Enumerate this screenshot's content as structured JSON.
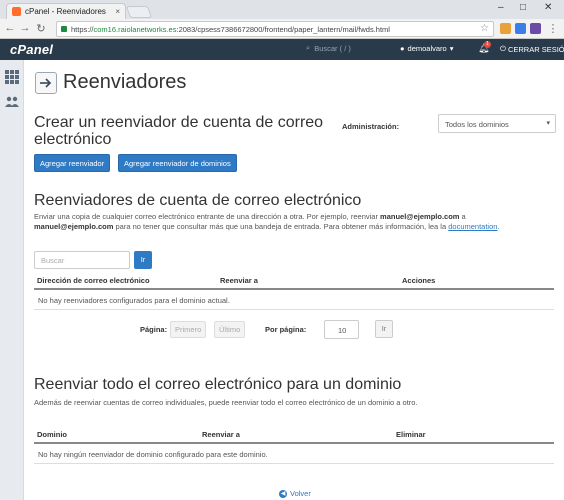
{
  "browser": {
    "tab_title": "cPanel - Reenviadores",
    "tab_close": "×",
    "url_prefix": "https://",
    "url_host": "com16.raiolanetworks.es",
    "url_path": ":2083/cpsess7386672800/frontend/paper_lantern/mail/fwds.html"
  },
  "header": {
    "logo": "cPanel",
    "search_placeholder": "Buscar ( / )",
    "user": "demoalvaro",
    "notifications": "1",
    "logout": "CERRAR SESIÓN"
  },
  "page": {
    "title": "Reenviadores"
  },
  "create_section": {
    "title": "Crear un reenviador de cuenta de correo electrónico",
    "admin_label": "Administración:",
    "admin_value": "Todos los dominios",
    "btn_add": "Agregar reenviador",
    "btn_add_domain": "Agregar reenviador de dominios"
  },
  "account_section": {
    "title": "Reenviadores de cuenta de correo electrónico",
    "desc_1": "Enviar una copia de cualquier correo electrónico entrante de una dirección a otra. Por ejemplo, reenviar ",
    "desc_email_1": "manuel@ejemplo.com",
    "desc_2": " a ",
    "desc_email_2": "manuel@ejemplo.com",
    "desc_3": " para no tener que consultar más que una bandeja de entrada. Para obtener más información, lea la ",
    "desc_link": "documentation",
    "desc_4": ".",
    "search_placeholder": "Buscar",
    "search_btn": "Ir",
    "columns": [
      "Dirección de correo electrónico",
      "Reenviar a",
      "Acciones"
    ],
    "empty": "No hay reenviadores configurados para el dominio actual.",
    "pagination": {
      "page_label": "Página:",
      "first": "Primero",
      "last": "Último",
      "per_page_label": "Por página:",
      "per_page_value": "10",
      "go": "Ir"
    }
  },
  "domain_section": {
    "title": "Reenviar todo el correo electrónico para un dominio",
    "desc": "Además de reenviar cuentas de correo individuales, puede reenviar todo el correo electrónico de un dominio a otro.",
    "columns": [
      "Dominio",
      "Reenviar a",
      "Eliminar"
    ],
    "empty": "No hay ningún reenviador de dominio configurado para este dominio."
  },
  "footer": {
    "back": "Volver"
  },
  "colors": {
    "header_bg": "#293a4a",
    "primary": "#2f7ac4"
  }
}
